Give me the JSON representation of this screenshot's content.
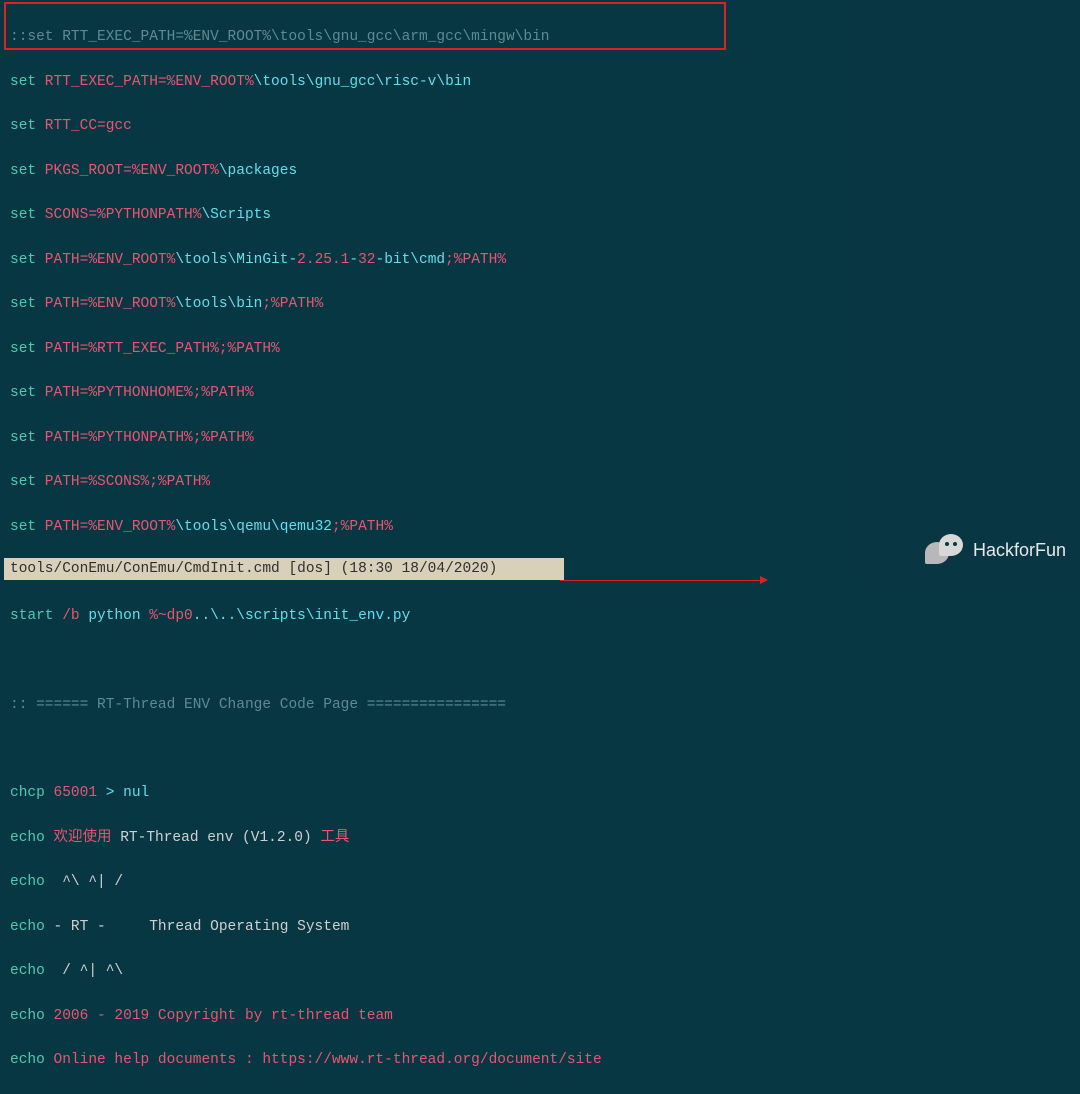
{
  "lines": {
    "l1_comment": "::set RTT_EXEC_PATH=%ENV_ROOT%\\tools\\gnu_gcc\\arm_gcc\\mingw\\bin",
    "l2_set": "set",
    "l2_var": " RTT_EXEC_PATH=%ENV_ROOT%",
    "l2_path": "\\tools\\gnu_gcc\\risc-v\\bin",
    "l3_set": "set",
    "l3_var": " RTT_CC=gcc",
    "l4_set": "set",
    "l4_var": " PKGS_ROOT=%ENV_ROOT%",
    "l4_path": "\\packages",
    "l5_set": "set",
    "l5_var": " SCONS=%PYTHONPATH%",
    "l5_path": "\\Scripts",
    "l6_set": "set",
    "l6_var": " PATH=%ENV_ROOT%",
    "l6_path": "\\tools\\MinGit-",
    "l6_num1": "2.25.1",
    "l6_dash": "-",
    "l6_num2": "32",
    "l6_path2": "-bit\\cmd",
    "l6_var2": ";%PATH%",
    "l7_set": "set",
    "l7_var": " PATH=%ENV_ROOT%",
    "l7_path": "\\tools\\bin",
    "l7_var2": ";%PATH%",
    "l8_set": "set",
    "l8_var": " PATH=%RTT_EXEC_PATH%;%PATH%",
    "l9_set": "set",
    "l9_var": " PATH=%PYTHONHOME%;%PATH%",
    "l10_set": "set",
    "l10_var": " PATH=%PYTHONPATH%;%PATH%",
    "l11_set": "set",
    "l11_var": " PATH=%SCONS%;%PATH%",
    "l12_set": "set",
    "l12_var": " PATH=%ENV_ROOT%",
    "l12_path": "\\tools\\qemu\\qemu32",
    "l12_var2": ";%PATH%",
    "l13_start": "start",
    "l13_opt": " /b",
    "l13_cmd": " python",
    "l13_var": " %~dp0",
    "l13_path": "..\\..\\scripts\\init_env.py",
    "l14_comment": ":: ====== RT-Thread ENV Change Code Page ================",
    "l15_cmd": "chcp",
    "l15_num": " 65001",
    "l15_redir": " > nul",
    "l16_echo": "echo",
    "l16_cn": " 欢迎使用",
    "l16_txt": " RT-Thread env (V1.2.0)",
    "l16_cn2": " 工具",
    "l17_echo": "echo",
    "l17_txt": "  ^\\ ^| /",
    "l18_echo": "echo",
    "l18_txt": " - RT -     Thread Operating System",
    "l19_echo": "echo",
    "l19_txt": "  / ^| ^\\",
    "l20_echo": "echo",
    "l20_txt": " 2006 - 2019 Copyright by rt-thread team",
    "l21_echo": "echo",
    "l21_txt": " Online help documents : https://www.rt-thread.org/document/site"
  },
  "status": {
    "path": "tools/ConEmu/ConEmu/CmdInit.cmd",
    "mode": "[dos]",
    "time": "(18:30 18/04/2020)"
  },
  "watermark": {
    "text": "HackforFun"
  }
}
